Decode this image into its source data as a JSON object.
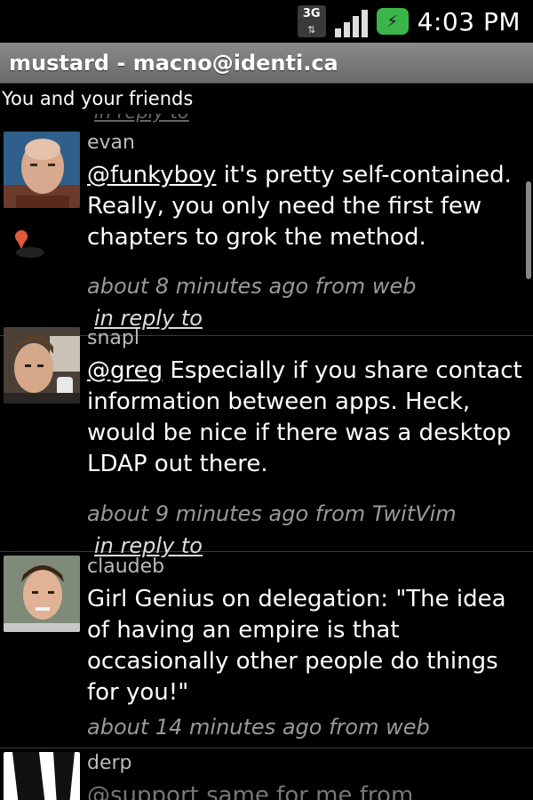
{
  "status_bar": {
    "network": "3G",
    "time": "4:03 PM",
    "icons": [
      "3g-network-icon",
      "signal-strength-icon",
      "battery-charging-icon"
    ]
  },
  "app": {
    "title": "mustard - macno@identi.ca",
    "subtitle": "You and your friends"
  },
  "timeline": {
    "partial_top_text": "in reply to",
    "notices": [
      {
        "user": "evan",
        "mention": "@funkyboy",
        "body": " it's pretty self-contained. Really, you only need the first few chapters to grok the method.",
        "meta": "about 8 minutes ago from web",
        "reply": "in reply to",
        "has_location": true
      },
      {
        "user": "snapl",
        "mention": "@greg",
        "body": " Especially if you share contact information between apps. Heck, would be nice if there was a desktop LDAP out there.",
        "meta": "about 9 minutes ago from TwitVim",
        "reply": "in reply to",
        "has_location": false
      },
      {
        "user": "claudeb",
        "mention": "",
        "body": "Girl Genius on delegation: \"The idea of having an empire is that occasionally other people do things for you!\"",
        "meta": "about 14 minutes ago from web",
        "reply": "",
        "has_location": false
      },
      {
        "user": "derp",
        "mention": "@support",
        "body": " same for me from",
        "meta": "",
        "reply": "",
        "has_location": false
      }
    ]
  },
  "colors": {
    "background": "#000000",
    "title_bar": "#7a7a7a",
    "battery": "#3bb54a",
    "meta_text": "#999999"
  }
}
